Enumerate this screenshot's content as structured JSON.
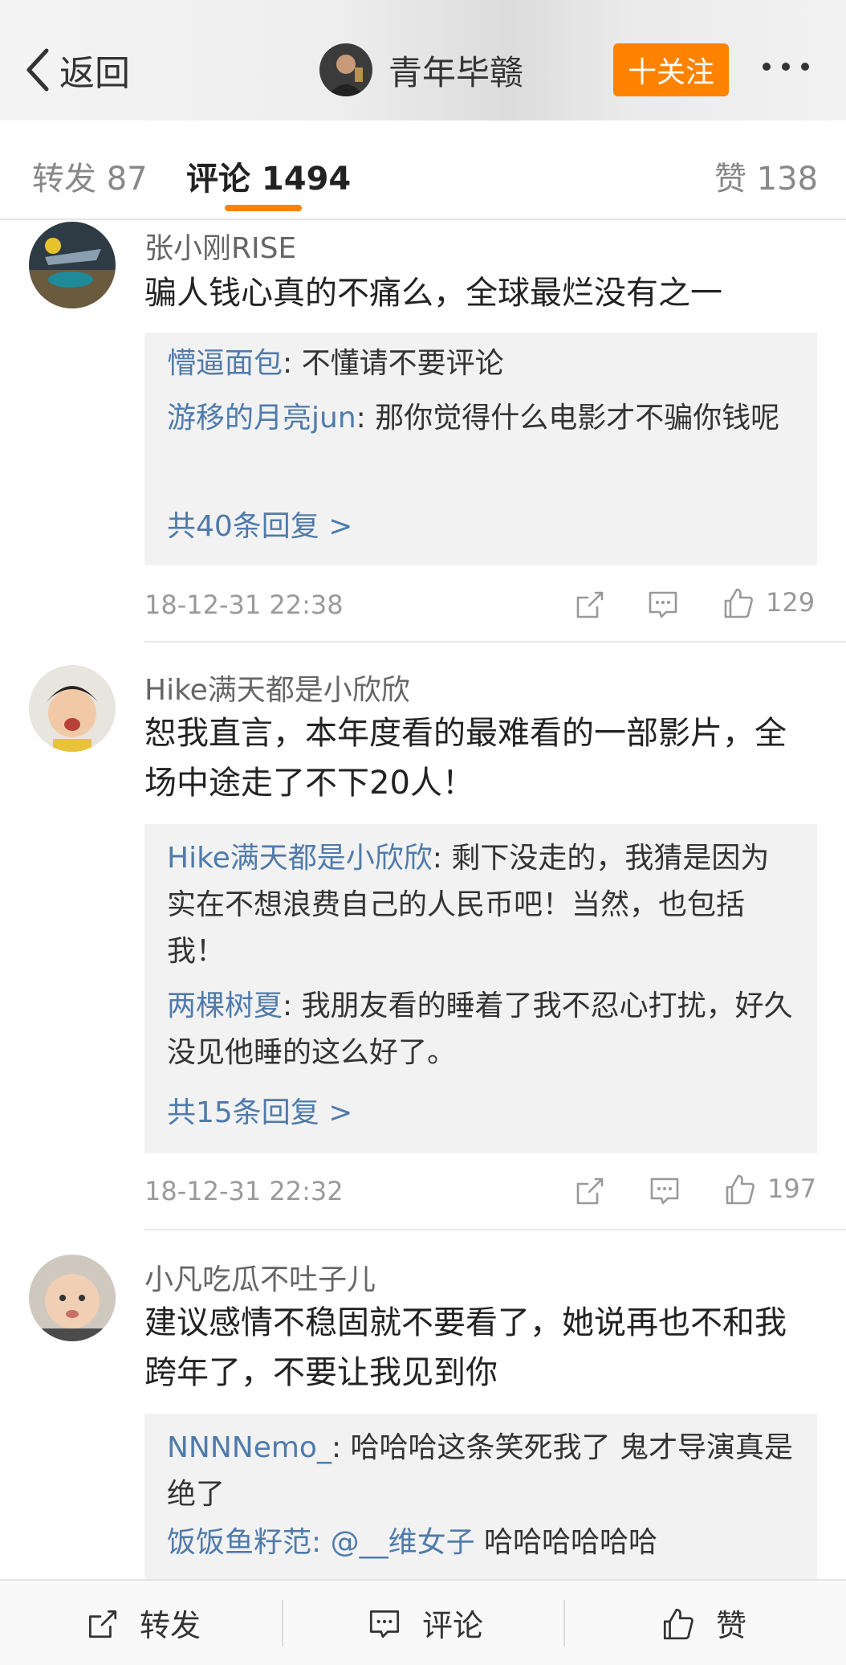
{
  "header": {
    "back_label": "返回",
    "user_name": "青年毕赣",
    "follow_label": "十关注"
  },
  "tabs": {
    "repost": "转发 87",
    "comment": "评论 1494",
    "like": "赞 138"
  },
  "comments": [
    {
      "name": "张小刚RISE",
      "text": "骗人钱心真的不痛么，全球最烂没有之一",
      "replies": [
        {
          "user": "懵逼面包",
          "text": ": 不懂请不要评论"
        },
        {
          "user": "游移的月亮jun",
          "text": ": 那你觉得什么电影才不骗你钱呢"
        }
      ],
      "more_replies": "共40条回复 >",
      "time": "18-12-31 22:38",
      "likes": "129"
    },
    {
      "name": "Hike满天都是小欣欣",
      "text": "恕我直言，本年度看的最难看的一部影片，全场中途走了不下20人！",
      "replies": [
        {
          "user": "Hike满天都是小欣欣",
          "text": ": 剩下没走的，我猜是因为实在不想浪费自己的人民币吧！当然，也包括我！"
        },
        {
          "user": "两棵树夏",
          "text": ": 我朋友看的睡着了我不忍心打扰，好久没见他睡的这么好了。"
        }
      ],
      "more_replies": "共15条回复 >",
      "time": "18-12-31 22:32",
      "likes": "197"
    },
    {
      "name": "小凡吃瓜不吐子儿",
      "text": "建议感情不稳固就不要看了，她说再也不和我跨年了，不要让我见到你",
      "replies": [
        {
          "user": "NNNNemo_",
          "text": ": 哈哈哈这条笑死我了 鬼才导演真是绝了"
        },
        {
          "user": "饭饭鱼籽范",
          "mention": ": @__维女子",
          "text": " 哈哈哈哈哈哈"
        }
      ]
    }
  ],
  "bottom_bar": {
    "repost": "转发",
    "comment": "评论",
    "like": "赞"
  },
  "colors": {
    "accent": "#ff8200",
    "link": "#4f7bab",
    "meta": "#9a9a9a"
  },
  "icons": [
    "chevron-left-icon",
    "share-icon",
    "comment-icon",
    "thumbs-up-icon",
    "more-dots-icon"
  ]
}
